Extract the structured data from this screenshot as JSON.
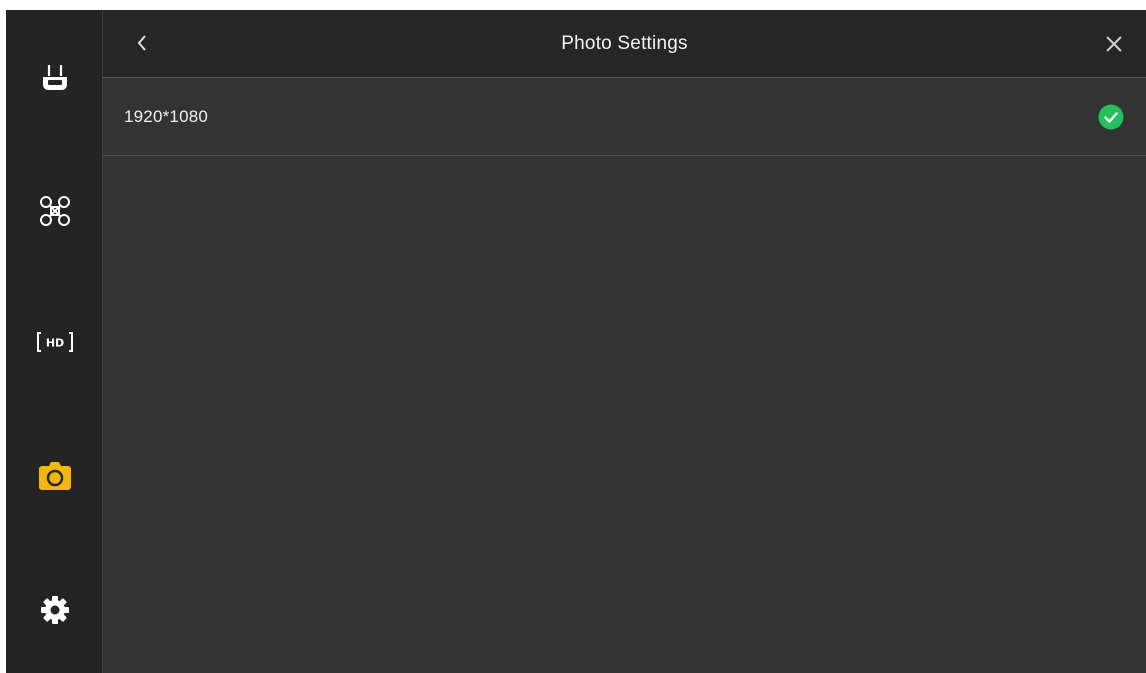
{
  "header": {
    "title": "Photo Settings",
    "back_icon": "chevron-left-icon",
    "close_icon": "close-icon"
  },
  "sidebar": {
    "items": [
      {
        "icon": "remote-controller-icon",
        "active": false
      },
      {
        "icon": "drone-icon",
        "active": false
      },
      {
        "icon": "hd-transmission-icon",
        "active": false
      },
      {
        "icon": "camera-icon",
        "active": true
      },
      {
        "icon": "gear-icon",
        "active": false
      }
    ]
  },
  "options": [
    {
      "label": "1920*1080",
      "selected": true,
      "icon": "check-circle-icon"
    }
  ],
  "colors": {
    "accent": "#f5b800",
    "check": "#21c15c",
    "icon": "#ffffff",
    "background": "#333333",
    "sidebar": "#242424"
  }
}
